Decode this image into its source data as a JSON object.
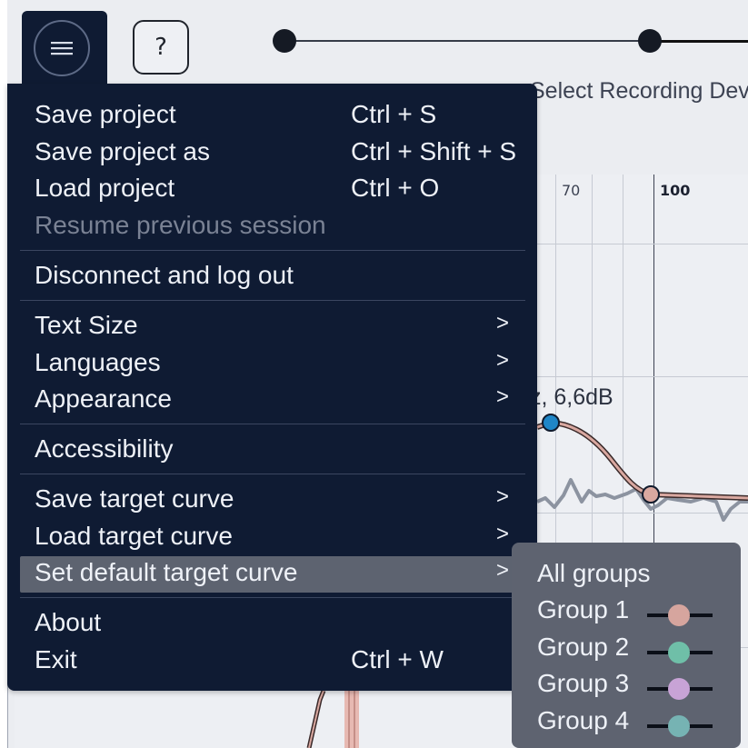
{
  "toolbar": {
    "menu_icon": "hamburger-icon",
    "help_label": "?",
    "step_label": "Select Recording Devi"
  },
  "chart": {
    "ticks": [
      "70",
      "100"
    ],
    "point_label": "z, 6,6dB",
    "colors": {
      "target_curve": "#d9a8a0",
      "point_active": "#1f86c7",
      "measurement": "#8c93a0"
    }
  },
  "menu": {
    "items": [
      {
        "label": "Save project",
        "shortcut": "Ctrl + S"
      },
      {
        "label": "Save project as",
        "shortcut": "Ctrl + Shift + S"
      },
      {
        "label": "Load project",
        "shortcut": "Ctrl + O"
      },
      {
        "label": "Resume previous session"
      },
      {
        "label": "Disconnect and log out"
      },
      {
        "label": "Text Size",
        "arrow": ">"
      },
      {
        "label": "Languages",
        "arrow": ">"
      },
      {
        "label": "Appearance",
        "arrow": ">"
      },
      {
        "label": "Accessibility"
      },
      {
        "label": "Save target curve",
        "arrow": ">"
      },
      {
        "label": "Load target curve",
        "arrow": ">"
      },
      {
        "label": "Set default target curve",
        "arrow": ">"
      },
      {
        "label": "About"
      },
      {
        "label": "Exit",
        "shortcut": "Ctrl + W"
      }
    ]
  },
  "submenu": {
    "items": [
      {
        "label": "All groups"
      },
      {
        "label": "Group 1",
        "color": "#d6a59e"
      },
      {
        "label": "Group 2",
        "color": "#6fbfa8"
      },
      {
        "label": "Group 3",
        "color": "#c8a3d6"
      },
      {
        "label": "Group 4",
        "color": "#76b3b3"
      }
    ]
  }
}
